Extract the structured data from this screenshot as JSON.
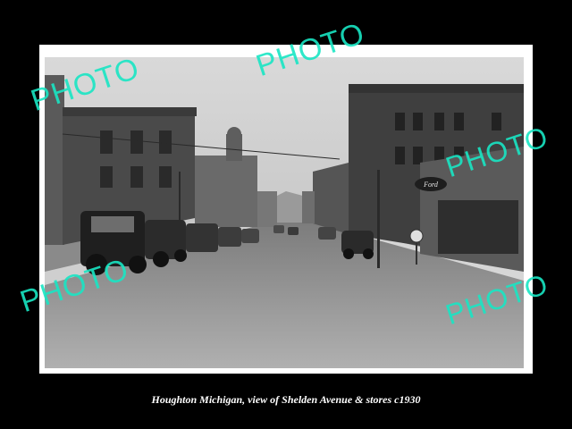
{
  "caption": "Houghton Michigan, view of Shelden Avenue & stores c1930",
  "watermarks": [
    "PHOTO",
    "PHOTO",
    "PHOTO",
    "PHOTO",
    "PHOTO"
  ],
  "signage": {
    "ford_sign": "Ford"
  },
  "colors": {
    "background": "#000000",
    "frame": "#ffffff",
    "watermark": "#19e6c4",
    "caption": "#ffffff"
  }
}
